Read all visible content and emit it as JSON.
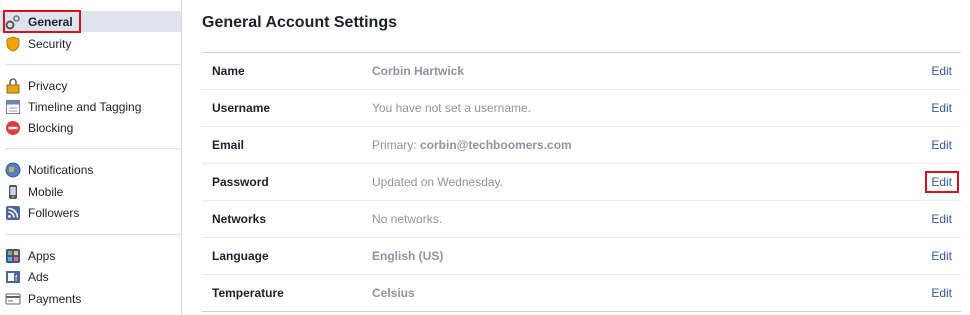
{
  "sidebar": {
    "items": [
      {
        "label": "General",
        "icon": "gears-icon"
      },
      {
        "label": "Security",
        "icon": "shield-icon"
      },
      {
        "label": "Privacy",
        "icon": "lock-icon"
      },
      {
        "label": "Timeline and Tagging",
        "icon": "timeline-icon"
      },
      {
        "label": "Blocking",
        "icon": "blocking-icon"
      },
      {
        "label": "Notifications",
        "icon": "globe-icon"
      },
      {
        "label": "Mobile",
        "icon": "mobile-icon"
      },
      {
        "label": "Followers",
        "icon": "rss-icon"
      },
      {
        "label": "Apps",
        "icon": "apps-icon"
      },
      {
        "label": "Ads",
        "icon": "ads-icon"
      },
      {
        "label": "Payments",
        "icon": "payments-icon"
      }
    ],
    "selected": "General"
  },
  "main": {
    "title": "General Account Settings",
    "rows": [
      {
        "label": "Name",
        "value": "Corbin Hartwick",
        "value_prefix": "",
        "edit": "Edit"
      },
      {
        "label": "Username",
        "value": "You have not set a username.",
        "value_prefix": "",
        "edit": "Edit"
      },
      {
        "label": "Email",
        "value": "corbin@techboomers.com",
        "value_prefix": "Primary: ",
        "edit": "Edit"
      },
      {
        "label": "Password",
        "value": "Updated on Wednesday.",
        "value_prefix": "",
        "edit": "Edit"
      },
      {
        "label": "Networks",
        "value": "No networks.",
        "value_prefix": "",
        "edit": "Edit"
      },
      {
        "label": "Language",
        "value": "English (US)",
        "value_prefix": "",
        "edit": "Edit"
      },
      {
        "label": "Temperature",
        "value": "Celsius",
        "value_prefix": "",
        "edit": "Edit"
      }
    ]
  },
  "colors": {
    "link": "#365899",
    "selected_bg": "#dfe3ee",
    "highlight": "#d3141c",
    "muted_text": "#90949c"
  }
}
